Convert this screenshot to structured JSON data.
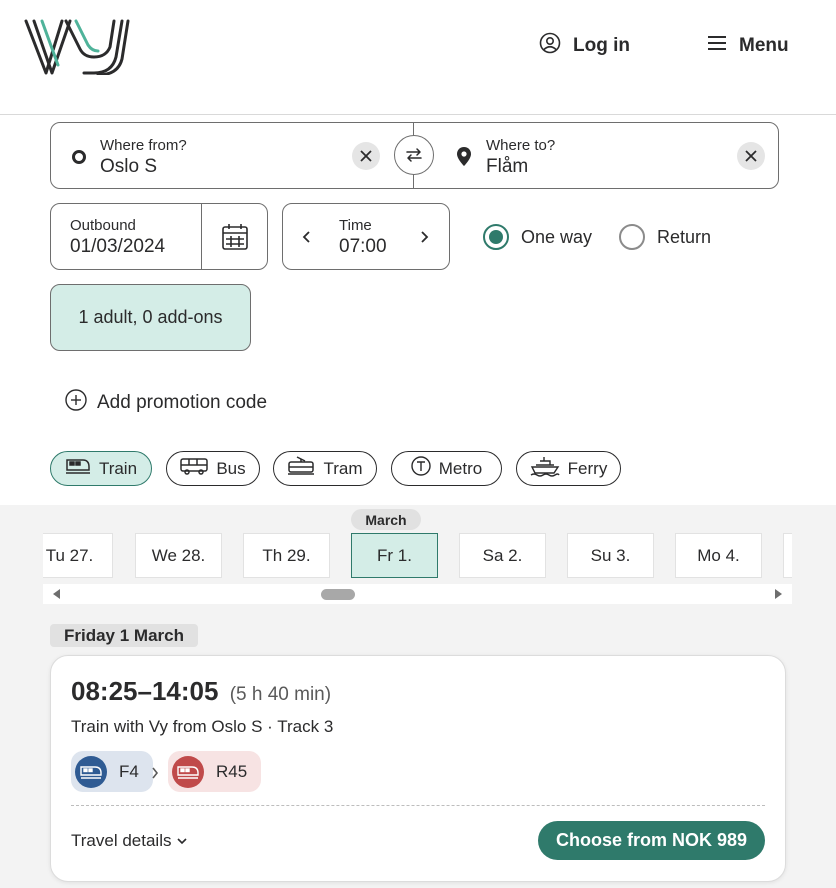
{
  "header": {
    "logo_text": "Vy",
    "login_label": "Log in",
    "menu_label": "Menu"
  },
  "search": {
    "from_label": "Where from?",
    "from_value": "Oslo S",
    "to_label": "Where to?",
    "to_value": "Flåm",
    "outbound_label": "Outbound",
    "outbound_value": "01/03/2024",
    "time_label": "Time",
    "time_value": "07:00",
    "trip_types": [
      {
        "label": "One way",
        "selected": true
      },
      {
        "label": "Return",
        "selected": false
      }
    ],
    "passengers_label": "1 adult, 0 add-ons",
    "promo_label": "Add promotion code"
  },
  "transport_modes": [
    {
      "label": "Train",
      "icon": "train-icon",
      "selected": true
    },
    {
      "label": "Bus",
      "icon": "bus-icon",
      "selected": false
    },
    {
      "label": "Tram",
      "icon": "tram-icon",
      "selected": false
    },
    {
      "label": "Metro",
      "icon": "metro-icon",
      "selected": false
    },
    {
      "label": "Ferry",
      "icon": "ferry-icon",
      "selected": false
    }
  ],
  "dates": {
    "month": "March",
    "items": [
      {
        "label": "Tu 27.",
        "selected": false
      },
      {
        "label": "We 28.",
        "selected": false
      },
      {
        "label": "Th 29.",
        "selected": false
      },
      {
        "label": "Fr 1.",
        "selected": true
      },
      {
        "label": "Sa 2.",
        "selected": false
      },
      {
        "label": "Su 3.",
        "selected": false
      },
      {
        "label": "Mo 4.",
        "selected": false
      }
    ]
  },
  "results": {
    "day_heading": "Friday 1 March",
    "trip": {
      "times": "08:25–14:05",
      "duration": "(5 h 40 min)",
      "description": "Train with Vy from Oslo S · Track 3",
      "legs": [
        {
          "line": "F4",
          "color": "#2f5b93",
          "bg": "#dde4ee"
        },
        {
          "line": "R45",
          "color": "#c04a4a",
          "bg": "#f7e3e3"
        }
      ],
      "details_label": "Travel details",
      "choose_label": "Choose from NOK 989"
    }
  },
  "colors": {
    "accent": "#2f7a6b",
    "accent_light": "#d4ede7",
    "text": "#2b2b2c"
  }
}
